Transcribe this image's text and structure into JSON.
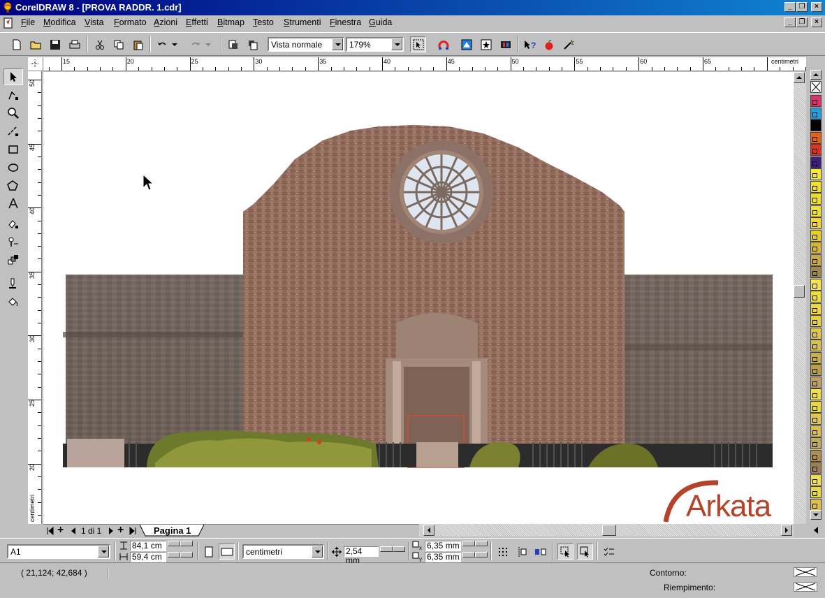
{
  "window": {
    "title": "CorelDRAW 8 - [PROVA RADDR. 1.cdr]"
  },
  "menu": {
    "items": [
      "File",
      "Modifica",
      "Vista",
      "Formato",
      "Azioni",
      "Effetti",
      "Bitmap",
      "Testo",
      "Strumenti",
      "Finestra",
      "Guida"
    ]
  },
  "toolbar": {
    "view_mode": "Vista normale",
    "zoom": "179%"
  },
  "rulers": {
    "unit_label": "centimetri",
    "horizontal_ticks": [
      "15",
      "20",
      "25",
      "30",
      "35",
      "40",
      "45",
      "50",
      "55",
      "60",
      "65"
    ],
    "vertical_ticks": [
      "50",
      "45",
      "40",
      "35",
      "30",
      "25",
      "20"
    ]
  },
  "pages": {
    "counter": "1 di 1",
    "tab_label": "Pagina 1"
  },
  "property_bar": {
    "paper_size": "A1",
    "width": "84,1 cm",
    "height": "59,4 cm",
    "units": "centimetri",
    "nudge": "2,54 mm",
    "dup_x": "6,35 mm",
    "dup_y": "6,35 mm"
  },
  "status": {
    "coordinates": "( 21,124; 42,684 )",
    "outline_label": "Contorno:",
    "fill_label": "Riempimento:"
  },
  "logo": {
    "text": "Arkata"
  },
  "palette": {
    "colors": [
      "#ffffff",
      "#e0306a",
      "#20a0e0",
      "#000000",
      "#e86010",
      "#e03020",
      "#402080",
      "#f8e830",
      "#f0e020",
      "#f0e020",
      "#f0e030",
      "#f0d830",
      "#e8d020",
      "#d8b830",
      "#c8a848",
      "#a08848",
      "#f8e840",
      "#f0e030",
      "#f0d840",
      "#e8d040",
      "#e0c848",
      "#d8c050",
      "#c8b048",
      "#b8a040",
      "#c0a060",
      "#f0e040",
      "#e8d838",
      "#e0c848",
      "#d8c050",
      "#c0a860",
      "#b09048",
      "#a08050",
      "#f0e048",
      "#e8d840",
      "#e0c040"
    ]
  }
}
